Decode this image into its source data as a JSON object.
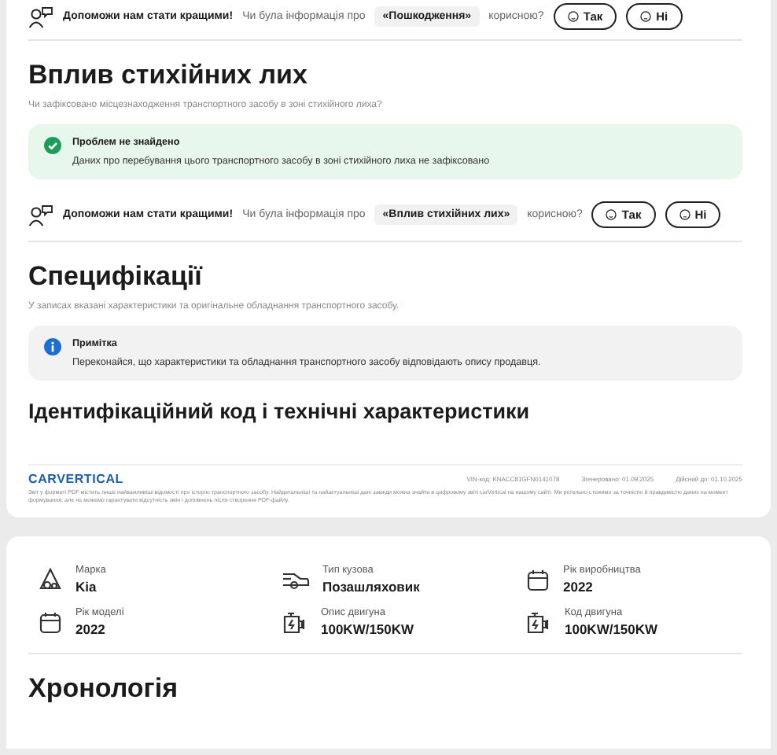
{
  "feedback_top": {
    "prompt": "Допоможи нам стати кращими!",
    "question_before": "Чи була інформація про",
    "topic": "«Пошкодження»",
    "question_after": "корисною?",
    "buttons": [
      {
        "kind": "yes",
        "label": "Так"
      },
      {
        "kind": "no",
        "label": "Ні"
      }
    ]
  },
  "disaster_section": {
    "title": "Вплив стихійних лих",
    "subtitle": "Чи зафіксовано місцезнаходження транспортного засобу в зоні стихійного лиха?",
    "alert": {
      "kind": "success",
      "title": "Проблем не знайдено",
      "text": "Даних про перебування цього транспортного засобу в зоні стихійного лиха не зафіксовано"
    },
    "feedback": {
      "prompt": "Допоможи нам стати кращими!",
      "question_before": "Чи була інформація про",
      "topic": "«Вплив стихійних лих»",
      "question_after": "корисною?",
      "buttons": [
        {
          "kind": "yes",
          "label": "Так"
        },
        {
          "kind": "no",
          "label": "Ні"
        }
      ]
    }
  },
  "specifications_section": {
    "title": "Специфікації",
    "subtitle": "У записах вказані характеристики та оригінальне обладнання транспортного засобу.",
    "alert": {
      "kind": "info",
      "title": "Примітка",
      "text": "Переконайся, що характеристики та обладнання транспортного засобу відповідають опису продавця."
    }
  },
  "id_section": {
    "title": "Ідентифікаційний код і технічні характеристики"
  },
  "footer": {
    "logo": "CARVERTICAL",
    "vin": "VIN-код: KNACC81GFN0141078",
    "generated": "Згенеровано: 01.09.2025",
    "valid_until": "Дійсний до: 01.10.2025",
    "disclaimer": "Звіт у форматі PDF містить лише найважливіші відомості про історію транспортного засобу. Найдетальніші та найактуальніші дані завжди можна знайти в цифровому звіті carVertical на нашому сайті. Ми ретельно стежимо за точністю й правдивістю даних на момент формування, але не можемо гарантувати відсутність змін і доповнень після створення PDF-файлу."
  },
  "specs": [
    {
      "kind": "brand",
      "label": "Марка",
      "value": "Kia"
    },
    {
      "kind": "body",
      "label": "Тип кузова",
      "value": "Позашляховик"
    },
    {
      "kind": "year",
      "label": "Рік виробництва",
      "value": "2022"
    },
    {
      "kind": "year",
      "label": "Рік моделі",
      "value": "2022"
    },
    {
      "kind": "engine",
      "label": "Опис двигуна",
      "value": "100KW/150KW"
    },
    {
      "kind": "engine",
      "label": "Код двигуна",
      "value": "100KW/150KW"
    }
  ],
  "timeline": {
    "title": "Хронологія"
  }
}
